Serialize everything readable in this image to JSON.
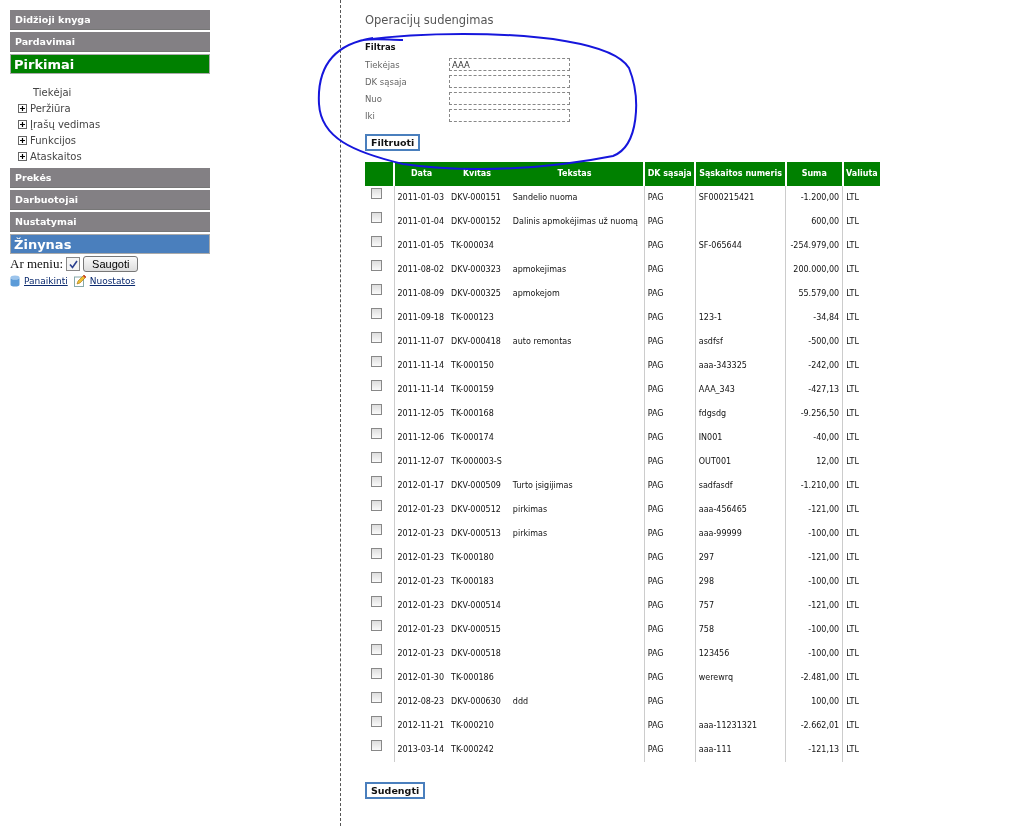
{
  "sidebar": {
    "menu": [
      {
        "label": "Didžioji knyga",
        "kind": "plain",
        "color": "#838084"
      },
      {
        "label": "Pardavimai",
        "kind": "plain",
        "color": "#838084"
      },
      {
        "label": "Pirkimai",
        "kind": "large",
        "color": "#008000",
        "children": [
          {
            "label": "Tiekėjai",
            "kind": "leaf"
          },
          {
            "label": "Peržiūra",
            "kind": "folder",
            "expanded": false
          },
          {
            "label": "Įrašų vedimas",
            "kind": "folder",
            "expanded": false
          },
          {
            "label": "Funkcijos",
            "kind": "folder",
            "expanded": false
          },
          {
            "label": "Ataskaitos",
            "kind": "folder",
            "expanded": false
          }
        ]
      },
      {
        "label": "Prekės",
        "kind": "plain",
        "color": "#838084"
      },
      {
        "label": "Darbuotojai",
        "kind": "plain",
        "color": "#838084"
      },
      {
        "label": "Nustatymai",
        "kind": "plain",
        "color": "#838084"
      },
      {
        "label": "Žinynas",
        "kind": "large",
        "color": "#4a7fbd"
      }
    ],
    "menu_toggle": {
      "label": "Ar meniu:",
      "checked": true,
      "button": "Saugoti"
    },
    "links": [
      {
        "label": "Panaikinti",
        "kind": "database"
      },
      {
        "label": "Nuostatos",
        "kind": "pencil"
      }
    ]
  },
  "main": {
    "title": "Operacijų sudengimas",
    "filter": {
      "title": "Filtras",
      "fields": [
        {
          "label": "Tiekėjas",
          "value": "AAA"
        },
        {
          "label": "DK sąsaja"
        },
        {
          "label": "Nuo"
        },
        {
          "label": "Iki"
        }
      ],
      "button": "Filtruoti"
    },
    "annotation": {
      "kind": "ellipse"
    },
    "table": {
      "columns": [
        "Data",
        "Kvitas",
        "Tekstas",
        "DK sąsaja",
        "Sąskaitos numeris",
        "Suma",
        "Valiuta"
      ],
      "rows": [
        {
          "checked": false,
          "date": "2011-01-03",
          "receipt": "DKV-000151",
          "text": "Sandelio nuoma",
          "account": "PAG",
          "invoice": "SF000215421",
          "amount": "-1.200,00",
          "currency": "LTL"
        },
        {
          "checked": false,
          "date": "2011-01-04",
          "receipt": "DKV-000152",
          "text": "Dalinis apmokėjimas už nuomą",
          "account": "PAG",
          "amount": "600,00",
          "currency": "LTL"
        },
        {
          "checked": false,
          "date": "2011-01-05",
          "receipt": "TK-000034",
          "account": "PAG",
          "invoice": "SF-065644",
          "amount": "-254.979,00",
          "currency": "LTL"
        },
        {
          "checked": false,
          "date": "2011-08-02",
          "receipt": "DKV-000323",
          "text": "apmokejimas",
          "account": "PAG",
          "amount": "200.000,00",
          "currency": "LTL"
        },
        {
          "checked": false,
          "date": "2011-08-09",
          "receipt": "DKV-000325",
          "text": "apmokejom",
          "account": "PAG",
          "amount": "55.579,00",
          "currency": "LTL"
        },
        {
          "checked": false,
          "date": "2011-09-18",
          "receipt": "TK-000123",
          "account": "PAG",
          "invoice": "123-1",
          "amount": "-34,84",
          "currency": "LTL"
        },
        {
          "checked": false,
          "date": "2011-11-07",
          "receipt": "DKV-000418",
          "text": "auto remontas",
          "account": "PAG",
          "invoice": "asdfsf",
          "amount": "-500,00",
          "currency": "LTL"
        },
        {
          "checked": false,
          "date": "2011-11-14",
          "receipt": "TK-000150",
          "account": "PAG",
          "invoice": "aaa-343325",
          "amount": "-242,00",
          "currency": "LTL"
        },
        {
          "checked": false,
          "date": "2011-11-14",
          "receipt": "TK-000159",
          "account": "PAG",
          "invoice": "AAA_343",
          "amount": "-427,13",
          "currency": "LTL"
        },
        {
          "checked": false,
          "date": "2011-12-05",
          "receipt": "TK-000168",
          "account": "PAG",
          "invoice": "fdgsdg",
          "amount": "-9.256,50",
          "currency": "LTL"
        },
        {
          "checked": false,
          "date": "2011-12-06",
          "receipt": "TK-000174",
          "account": "PAG",
          "invoice": "IN001",
          "amount": "-40,00",
          "currency": "LTL"
        },
        {
          "checked": false,
          "date": "2011-12-07",
          "receipt": "TK-000003-S",
          "account": "PAG",
          "invoice": "OUT001",
          "amount": "12,00",
          "currency": "LTL"
        },
        {
          "checked": false,
          "date": "2012-01-17",
          "receipt": "DKV-000509",
          "text": "Turto įsigijimas",
          "account": "PAG",
          "invoice": "sadfasdf",
          "amount": "-1.210,00",
          "currency": "LTL"
        },
        {
          "checked": false,
          "date": "2012-01-23",
          "receipt": "DKV-000512",
          "text": "pirkimas",
          "account": "PAG",
          "invoice": "aaa-456465",
          "amount": "-121,00",
          "currency": "LTL"
        },
        {
          "checked": false,
          "date": "2012-01-23",
          "receipt": "DKV-000513",
          "text": "pirkimas",
          "account": "PAG",
          "invoice": "aaa-99999",
          "amount": "-100,00",
          "currency": "LTL"
        },
        {
          "checked": false,
          "date": "2012-01-23",
          "receipt": "TK-000180",
          "account": "PAG",
          "invoice": "297",
          "amount": "-121,00",
          "currency": "LTL"
        },
        {
          "checked": false,
          "date": "2012-01-23",
          "receipt": "TK-000183",
          "account": "PAG",
          "invoice": "298",
          "amount": "-100,00",
          "currency": "LTL"
        },
        {
          "checked": false,
          "date": "2012-01-23",
          "receipt": "DKV-000514",
          "account": "PAG",
          "invoice": "757",
          "amount": "-121,00",
          "currency": "LTL"
        },
        {
          "checked": false,
          "date": "2012-01-23",
          "receipt": "DKV-000515",
          "account": "PAG",
          "invoice": "758",
          "amount": "-100,00",
          "currency": "LTL"
        },
        {
          "checked": false,
          "date": "2012-01-23",
          "receipt": "DKV-000518",
          "account": "PAG",
          "invoice": "123456",
          "amount": "-100,00",
          "currency": "LTL"
        },
        {
          "checked": false,
          "date": "2012-01-30",
          "receipt": "TK-000186",
          "account": "PAG",
          "invoice": "werewrq",
          "amount": "-2.481,00",
          "currency": "LTL"
        },
        {
          "checked": false,
          "date": "2012-08-23",
          "receipt": "DKV-000630",
          "text": "ddd",
          "account": "PAG",
          "amount": "100,00",
          "currency": "LTL"
        },
        {
          "checked": false,
          "date": "2012-11-21",
          "receipt": "TK-000210",
          "account": "PAG",
          "invoice": "aaa-11231321",
          "amount": "-2.662,01",
          "currency": "LTL"
        },
        {
          "checked": false,
          "date": "2013-03-14",
          "receipt": "TK-000242",
          "account": "PAG",
          "invoice": "aaa-111",
          "amount": "-121,13",
          "currency": "LTL"
        }
      ]
    },
    "button": "Sudengti"
  }
}
